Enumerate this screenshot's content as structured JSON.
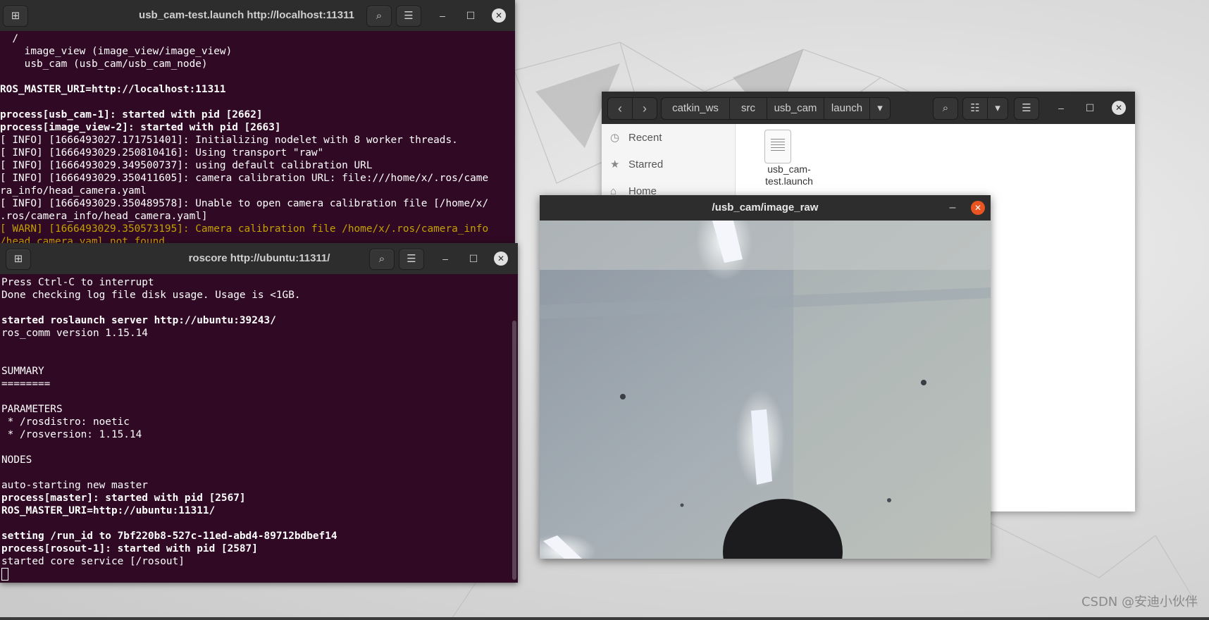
{
  "desktop": {
    "watermark": "CSDN @安迪小伙伴"
  },
  "terminal_launch": {
    "title": "usb_cam-test.launch http://localhost:11311",
    "lines": [
      {
        "text": "  /",
        "style": "normal"
      },
      {
        "text": "    image_view (image_view/image_view)",
        "style": "normal"
      },
      {
        "text": "    usb_cam (usb_cam/usb_cam_node)",
        "style": "normal"
      },
      {
        "text": "",
        "style": "normal"
      },
      {
        "text": "ROS_MASTER_URI=http://localhost:11311",
        "style": "bold"
      },
      {
        "text": "",
        "style": "normal"
      },
      {
        "text": "process[usb_cam-1]: started with pid [2662]",
        "style": "bold"
      },
      {
        "text": "process[image_view-2]: started with pid [2663]",
        "style": "bold"
      },
      {
        "text": "[ INFO] [1666493027.171751401]: Initializing nodelet with 8 worker threads.",
        "style": "normal"
      },
      {
        "text": "[ INFO] [1666493029.250810416]: Using transport \"raw\"",
        "style": "normal"
      },
      {
        "text": "[ INFO] [1666493029.349500737]: using default calibration URL",
        "style": "normal"
      },
      {
        "text": "[ INFO] [1666493029.350411605]: camera calibration URL: file:///home/x/.ros/came",
        "style": "normal"
      },
      {
        "text": "ra_info/head_camera.yaml",
        "style": "normal"
      },
      {
        "text": "[ INFO] [1666493029.350489578]: Unable to open camera calibration file [/home/x/",
        "style": "normal"
      },
      {
        "text": ".ros/camera_info/head_camera.yaml]",
        "style": "normal"
      },
      {
        "text": "[ WARN] [1666493029.350573195]: Camera calibration file /home/x/.ros/camera_info",
        "style": "warn"
      },
      {
        "text": "/head_camera.yaml not found.",
        "style": "warn"
      }
    ]
  },
  "terminal_roscore": {
    "title": "roscore http://ubuntu:11311/",
    "lines": [
      {
        "text": "Press Ctrl-C to interrupt",
        "style": "normal"
      },
      {
        "text": "Done checking log file disk usage. Usage is <1GB.",
        "style": "normal"
      },
      {
        "text": "",
        "style": "normal"
      },
      {
        "text": "started roslaunch server http://ubuntu:39243/",
        "style": "bold"
      },
      {
        "text": "ros_comm version 1.15.14",
        "style": "normal"
      },
      {
        "text": "",
        "style": "normal"
      },
      {
        "text": "",
        "style": "normal"
      },
      {
        "text": "SUMMARY",
        "style": "normal"
      },
      {
        "text": "========",
        "style": "normal"
      },
      {
        "text": "",
        "style": "normal"
      },
      {
        "text": "PARAMETERS",
        "style": "normal"
      },
      {
        "text": " * /rosdistro: noetic",
        "style": "normal"
      },
      {
        "text": " * /rosversion: 1.15.14",
        "style": "normal"
      },
      {
        "text": "",
        "style": "normal"
      },
      {
        "text": "NODES",
        "style": "normal"
      },
      {
        "text": "",
        "style": "normal"
      },
      {
        "text": "auto-starting new master",
        "style": "normal"
      },
      {
        "text": "process[master]: started with pid [2567]",
        "style": "bold"
      },
      {
        "text": "ROS_MASTER_URI=http://ubuntu:11311/",
        "style": "bold"
      },
      {
        "text": "",
        "style": "normal"
      },
      {
        "text": "setting /run_id to 7bf220b8-527c-11ed-abd4-89712bdbef14",
        "style": "bold"
      },
      {
        "text": "process[rosout-1]: started with pid [2587]",
        "style": "bold"
      },
      {
        "text": "started core service [/rosout]",
        "style": "normal"
      }
    ]
  },
  "files": {
    "breadcrumbs": [
      "catkin_ws",
      "src",
      "usb_cam",
      "launch"
    ],
    "sidebar": [
      {
        "label": "Recent",
        "icon": "clock-icon"
      },
      {
        "label": "Starred",
        "icon": "star-icon"
      },
      {
        "label": "Home",
        "icon": "home-icon"
      }
    ],
    "file": {
      "name_line1": "usb_cam-",
      "name_line2": "test.launch"
    }
  },
  "viewer": {
    "title": "/usb_cam/image_raw"
  },
  "glyphs": {
    "new_tab": "⊞",
    "search": "⌕",
    "menu": "☰",
    "minimize": "–",
    "maximize": "☐",
    "close": "✕",
    "back": "‹",
    "forward": "›",
    "dropdown": "▾",
    "list": "☷"
  }
}
